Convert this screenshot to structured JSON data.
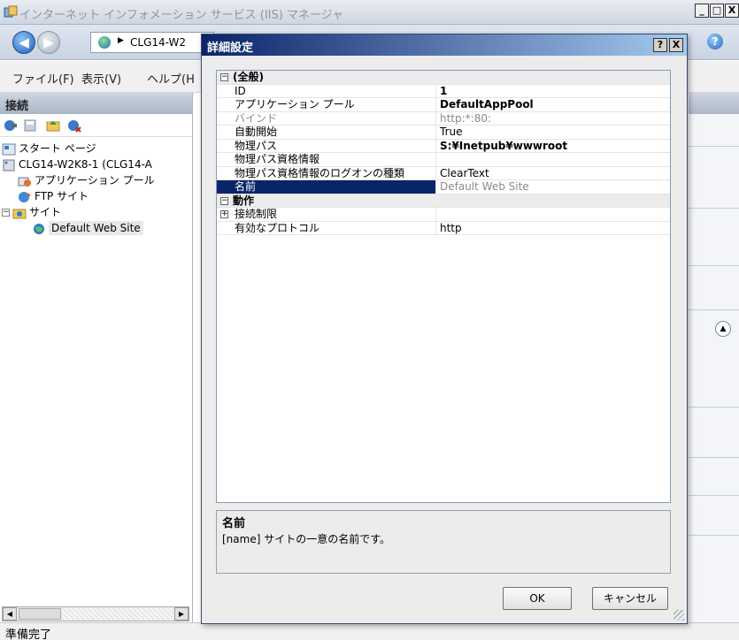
{
  "window": {
    "title": "インターネット インフォメーション サービス (IIS) マネージャ",
    "minimize": "_",
    "maximize": "□",
    "close": "X"
  },
  "address": {
    "path": "CLG14-W2",
    "help_icon": "help-icon"
  },
  "menu": {
    "file": "ファイル(F)",
    "view": "表示(V)",
    "help": "ヘルプ(H"
  },
  "connections": {
    "header": "接続",
    "tree": [
      {
        "label": "スタート ページ",
        "icon": "start-page-icon"
      },
      {
        "label": "CLG14-W2K8-1 (CLG14-A",
        "icon": "server-icon"
      },
      {
        "label": "アプリケーション プール",
        "icon": "app-pool-icon"
      },
      {
        "label": "FTP サイト",
        "icon": "ftp-site-icon"
      },
      {
        "label": "サイト",
        "icon": "sites-folder-icon"
      },
      {
        "label": "Default Web Site",
        "icon": "globe-icon"
      }
    ]
  },
  "status": {
    "text": "準備完了"
  },
  "dialog": {
    "title": "詳細設定",
    "help_button": "?",
    "close_button": "X",
    "categories": {
      "general": "(全般)",
      "behavior": "動作"
    },
    "properties": [
      {
        "name": "ID",
        "value": "1"
      },
      {
        "name": "アプリケーション プール",
        "value": "DefaultAppPool"
      },
      {
        "name": "バインド",
        "value": "http:*:80:"
      },
      {
        "name": "自動開始",
        "value": "True"
      },
      {
        "name": "物理パス",
        "value": "S:¥Inetpub¥wwwroot"
      },
      {
        "name": "物理パス資格情報",
        "value": ""
      },
      {
        "name": "物理パス資格情報のログオンの種類",
        "value": "ClearText"
      },
      {
        "name": "名前",
        "value": "Default Web Site"
      },
      {
        "name": "接続制限",
        "value": ""
      },
      {
        "name": "有効なプロトコル",
        "value": "http"
      }
    ],
    "description": {
      "title": "名前",
      "text": "[name] サイトの一意の名前です。"
    },
    "ok_label": "OK",
    "cancel_label": "キャンセル"
  },
  "colors": {
    "dialog_title_start": "#0a246a",
    "dialog_title_end": "#a6caf0",
    "selection": "#0a246a"
  }
}
